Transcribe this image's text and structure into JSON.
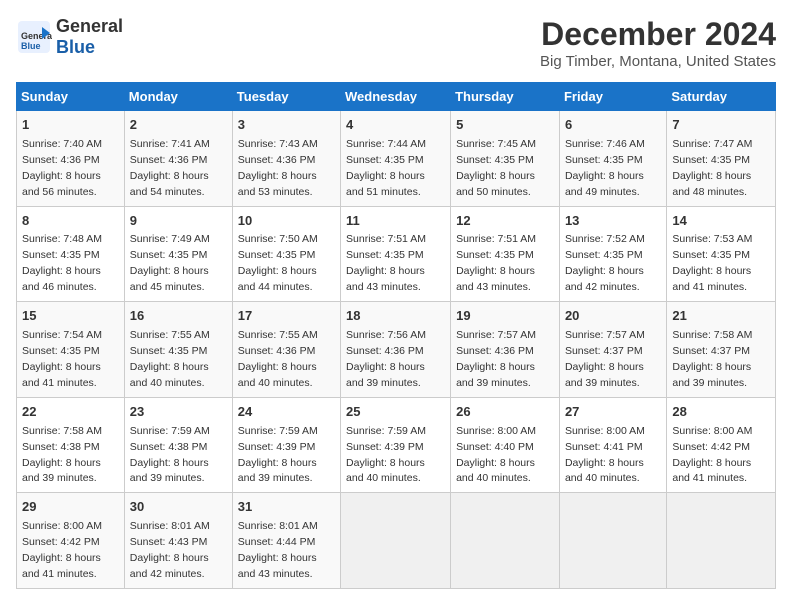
{
  "header": {
    "logo_line1": "General",
    "logo_line2": "Blue",
    "title": "December 2024",
    "subtitle": "Big Timber, Montana, United States"
  },
  "calendar": {
    "days_of_week": [
      "Sunday",
      "Monday",
      "Tuesday",
      "Wednesday",
      "Thursday",
      "Friday",
      "Saturday"
    ],
    "weeks": [
      [
        {
          "day": "1",
          "sunrise": "7:40 AM",
          "sunset": "4:36 PM",
          "daylight": "8 hours and 56 minutes."
        },
        {
          "day": "2",
          "sunrise": "7:41 AM",
          "sunset": "4:36 PM",
          "daylight": "8 hours and 54 minutes."
        },
        {
          "day": "3",
          "sunrise": "7:43 AM",
          "sunset": "4:36 PM",
          "daylight": "8 hours and 53 minutes."
        },
        {
          "day": "4",
          "sunrise": "7:44 AM",
          "sunset": "4:35 PM",
          "daylight": "8 hours and 51 minutes."
        },
        {
          "day": "5",
          "sunrise": "7:45 AM",
          "sunset": "4:35 PM",
          "daylight": "8 hours and 50 minutes."
        },
        {
          "day": "6",
          "sunrise": "7:46 AM",
          "sunset": "4:35 PM",
          "daylight": "8 hours and 49 minutes."
        },
        {
          "day": "7",
          "sunrise": "7:47 AM",
          "sunset": "4:35 PM",
          "daylight": "8 hours and 48 minutes."
        }
      ],
      [
        {
          "day": "8",
          "sunrise": "7:48 AM",
          "sunset": "4:35 PM",
          "daylight": "8 hours and 46 minutes."
        },
        {
          "day": "9",
          "sunrise": "7:49 AM",
          "sunset": "4:35 PM",
          "daylight": "8 hours and 45 minutes."
        },
        {
          "day": "10",
          "sunrise": "7:50 AM",
          "sunset": "4:35 PM",
          "daylight": "8 hours and 44 minutes."
        },
        {
          "day": "11",
          "sunrise": "7:51 AM",
          "sunset": "4:35 PM",
          "daylight": "8 hours and 43 minutes."
        },
        {
          "day": "12",
          "sunrise": "7:51 AM",
          "sunset": "4:35 PM",
          "daylight": "8 hours and 43 minutes."
        },
        {
          "day": "13",
          "sunrise": "7:52 AM",
          "sunset": "4:35 PM",
          "daylight": "8 hours and 42 minutes."
        },
        {
          "day": "14",
          "sunrise": "7:53 AM",
          "sunset": "4:35 PM",
          "daylight": "8 hours and 41 minutes."
        }
      ],
      [
        {
          "day": "15",
          "sunrise": "7:54 AM",
          "sunset": "4:35 PM",
          "daylight": "8 hours and 41 minutes."
        },
        {
          "day": "16",
          "sunrise": "7:55 AM",
          "sunset": "4:35 PM",
          "daylight": "8 hours and 40 minutes."
        },
        {
          "day": "17",
          "sunrise": "7:55 AM",
          "sunset": "4:36 PM",
          "daylight": "8 hours and 40 minutes."
        },
        {
          "day": "18",
          "sunrise": "7:56 AM",
          "sunset": "4:36 PM",
          "daylight": "8 hours and 39 minutes."
        },
        {
          "day": "19",
          "sunrise": "7:57 AM",
          "sunset": "4:36 PM",
          "daylight": "8 hours and 39 minutes."
        },
        {
          "day": "20",
          "sunrise": "7:57 AM",
          "sunset": "4:37 PM",
          "daylight": "8 hours and 39 minutes."
        },
        {
          "day": "21",
          "sunrise": "7:58 AM",
          "sunset": "4:37 PM",
          "daylight": "8 hours and 39 minutes."
        }
      ],
      [
        {
          "day": "22",
          "sunrise": "7:58 AM",
          "sunset": "4:38 PM",
          "daylight": "8 hours and 39 minutes."
        },
        {
          "day": "23",
          "sunrise": "7:59 AM",
          "sunset": "4:38 PM",
          "daylight": "8 hours and 39 minutes."
        },
        {
          "day": "24",
          "sunrise": "7:59 AM",
          "sunset": "4:39 PM",
          "daylight": "8 hours and 39 minutes."
        },
        {
          "day": "25",
          "sunrise": "7:59 AM",
          "sunset": "4:39 PM",
          "daylight": "8 hours and 40 minutes."
        },
        {
          "day": "26",
          "sunrise": "8:00 AM",
          "sunset": "4:40 PM",
          "daylight": "8 hours and 40 minutes."
        },
        {
          "day": "27",
          "sunrise": "8:00 AM",
          "sunset": "4:41 PM",
          "daylight": "8 hours and 40 minutes."
        },
        {
          "day": "28",
          "sunrise": "8:00 AM",
          "sunset": "4:42 PM",
          "daylight": "8 hours and 41 minutes."
        }
      ],
      [
        {
          "day": "29",
          "sunrise": "8:00 AM",
          "sunset": "4:42 PM",
          "daylight": "8 hours and 41 minutes."
        },
        {
          "day": "30",
          "sunrise": "8:01 AM",
          "sunset": "4:43 PM",
          "daylight": "8 hours and 42 minutes."
        },
        {
          "day": "31",
          "sunrise": "8:01 AM",
          "sunset": "4:44 PM",
          "daylight": "8 hours and 43 minutes."
        },
        null,
        null,
        null,
        null
      ]
    ]
  }
}
